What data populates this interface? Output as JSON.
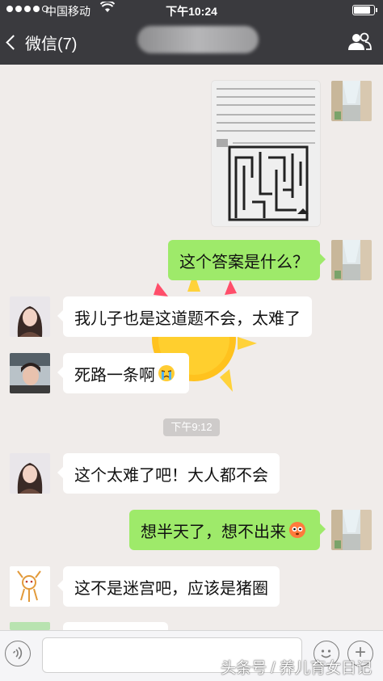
{
  "status_bar": {
    "carrier": "中国移动",
    "time": "下午10:24",
    "battery_level": 0.85
  },
  "nav": {
    "back_label": "微信(7)"
  },
  "messages": [
    {
      "side": "right",
      "type": "image"
    },
    {
      "side": "right",
      "text": "这个答案是什么？"
    },
    {
      "side": "left",
      "text": "我儿子也是这道题不会，太难了"
    },
    {
      "side": "left",
      "text": "死路一条啊",
      "emoji": "crying-face-icon"
    },
    {
      "side": "left",
      "text": "这个太难了吧！大人都不会"
    },
    {
      "side": "right",
      "text": "想半天了，想不出来",
      "emoji": "flushed-face-icon"
    },
    {
      "side": "left",
      "text": "这不是迷宫吧，应该是猪圈"
    }
  ],
  "timestamp": "下午9:12",
  "watermark": "头条号 / 养儿育女日记",
  "colors": {
    "nav_bg": "#3a3a3e",
    "chat_bg": "#f0ecea",
    "right_bubble": "#9eea6a",
    "left_bubble": "#ffffff"
  }
}
